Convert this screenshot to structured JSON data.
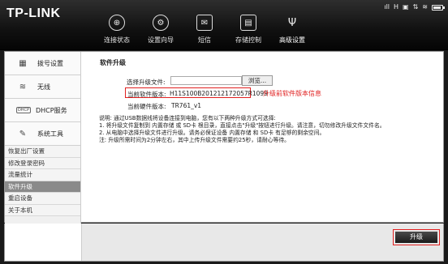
{
  "brand": {
    "logo": "TP-LINK"
  },
  "status_bar": {
    "signal": "ıll",
    "network": "H",
    "sim": "▣",
    "arrows": "⇅",
    "wifi": "≋"
  },
  "nav": [
    {
      "label": "连接状态",
      "icon": "globe-icon",
      "glyph": "⊕"
    },
    {
      "label": "设置向导",
      "icon": "wizard-icon",
      "glyph": "⚙"
    },
    {
      "label": "短信",
      "icon": "mail-icon",
      "glyph": "✉"
    },
    {
      "label": "存储控制",
      "icon": "storage-icon",
      "glyph": "▤"
    },
    {
      "label": "高级设置",
      "icon": "advanced-settings-icon",
      "glyph": "Ψ"
    }
  ],
  "sidebar": {
    "main": [
      {
        "label": "拨号设置",
        "icon": "dialup-icon",
        "glyph": "▦"
      },
      {
        "label": "无线",
        "icon": "wireless-icon",
        "glyph": "≋"
      },
      {
        "label": "DHCP服务",
        "icon": "dhcp-icon",
        "glyph": "DHCP"
      },
      {
        "label": "系统工具",
        "icon": "tools-icon",
        "glyph": "✎"
      }
    ],
    "sub": [
      "恢复出厂设置",
      "修改登录密码",
      "流量统计",
      "软件升级",
      "重启设备",
      "关于本机"
    ]
  },
  "main": {
    "title": "软件升级",
    "select_label": "选择升级文件:",
    "browse_label": "浏览...",
    "current_sw_label": "当前软件版本:",
    "current_sw_value": "H11S100B201212172057R1099",
    "annotation": "升级前软件版本信息",
    "current_hw_label": "当前硬件版本:",
    "current_hw_value": "TR761_v1",
    "notes": [
      "说明: 通过USB数据线将设备连接到电脑，您有以下两种升级方式可选择:",
      "1. 将升级文件复制到 内置存储 或 SD卡 根目录，直接点击\"升级\"按钮进行升级。请注意，切勿修改升级文件文件名。",
      "2. 从电脑中选择升级文件进行升级。请务必保证设备 内置存储 和 SD卡 有足够的剩余空间。",
      "注: 升级所需时间为2分钟左右，其中上传升级文件需要约25秒，请耐心等待。"
    ]
  },
  "footer": {
    "upgrade_label": "升级"
  },
  "colors": {
    "highlight": "#e02020",
    "active_sub": "#8a8a8a"
  }
}
